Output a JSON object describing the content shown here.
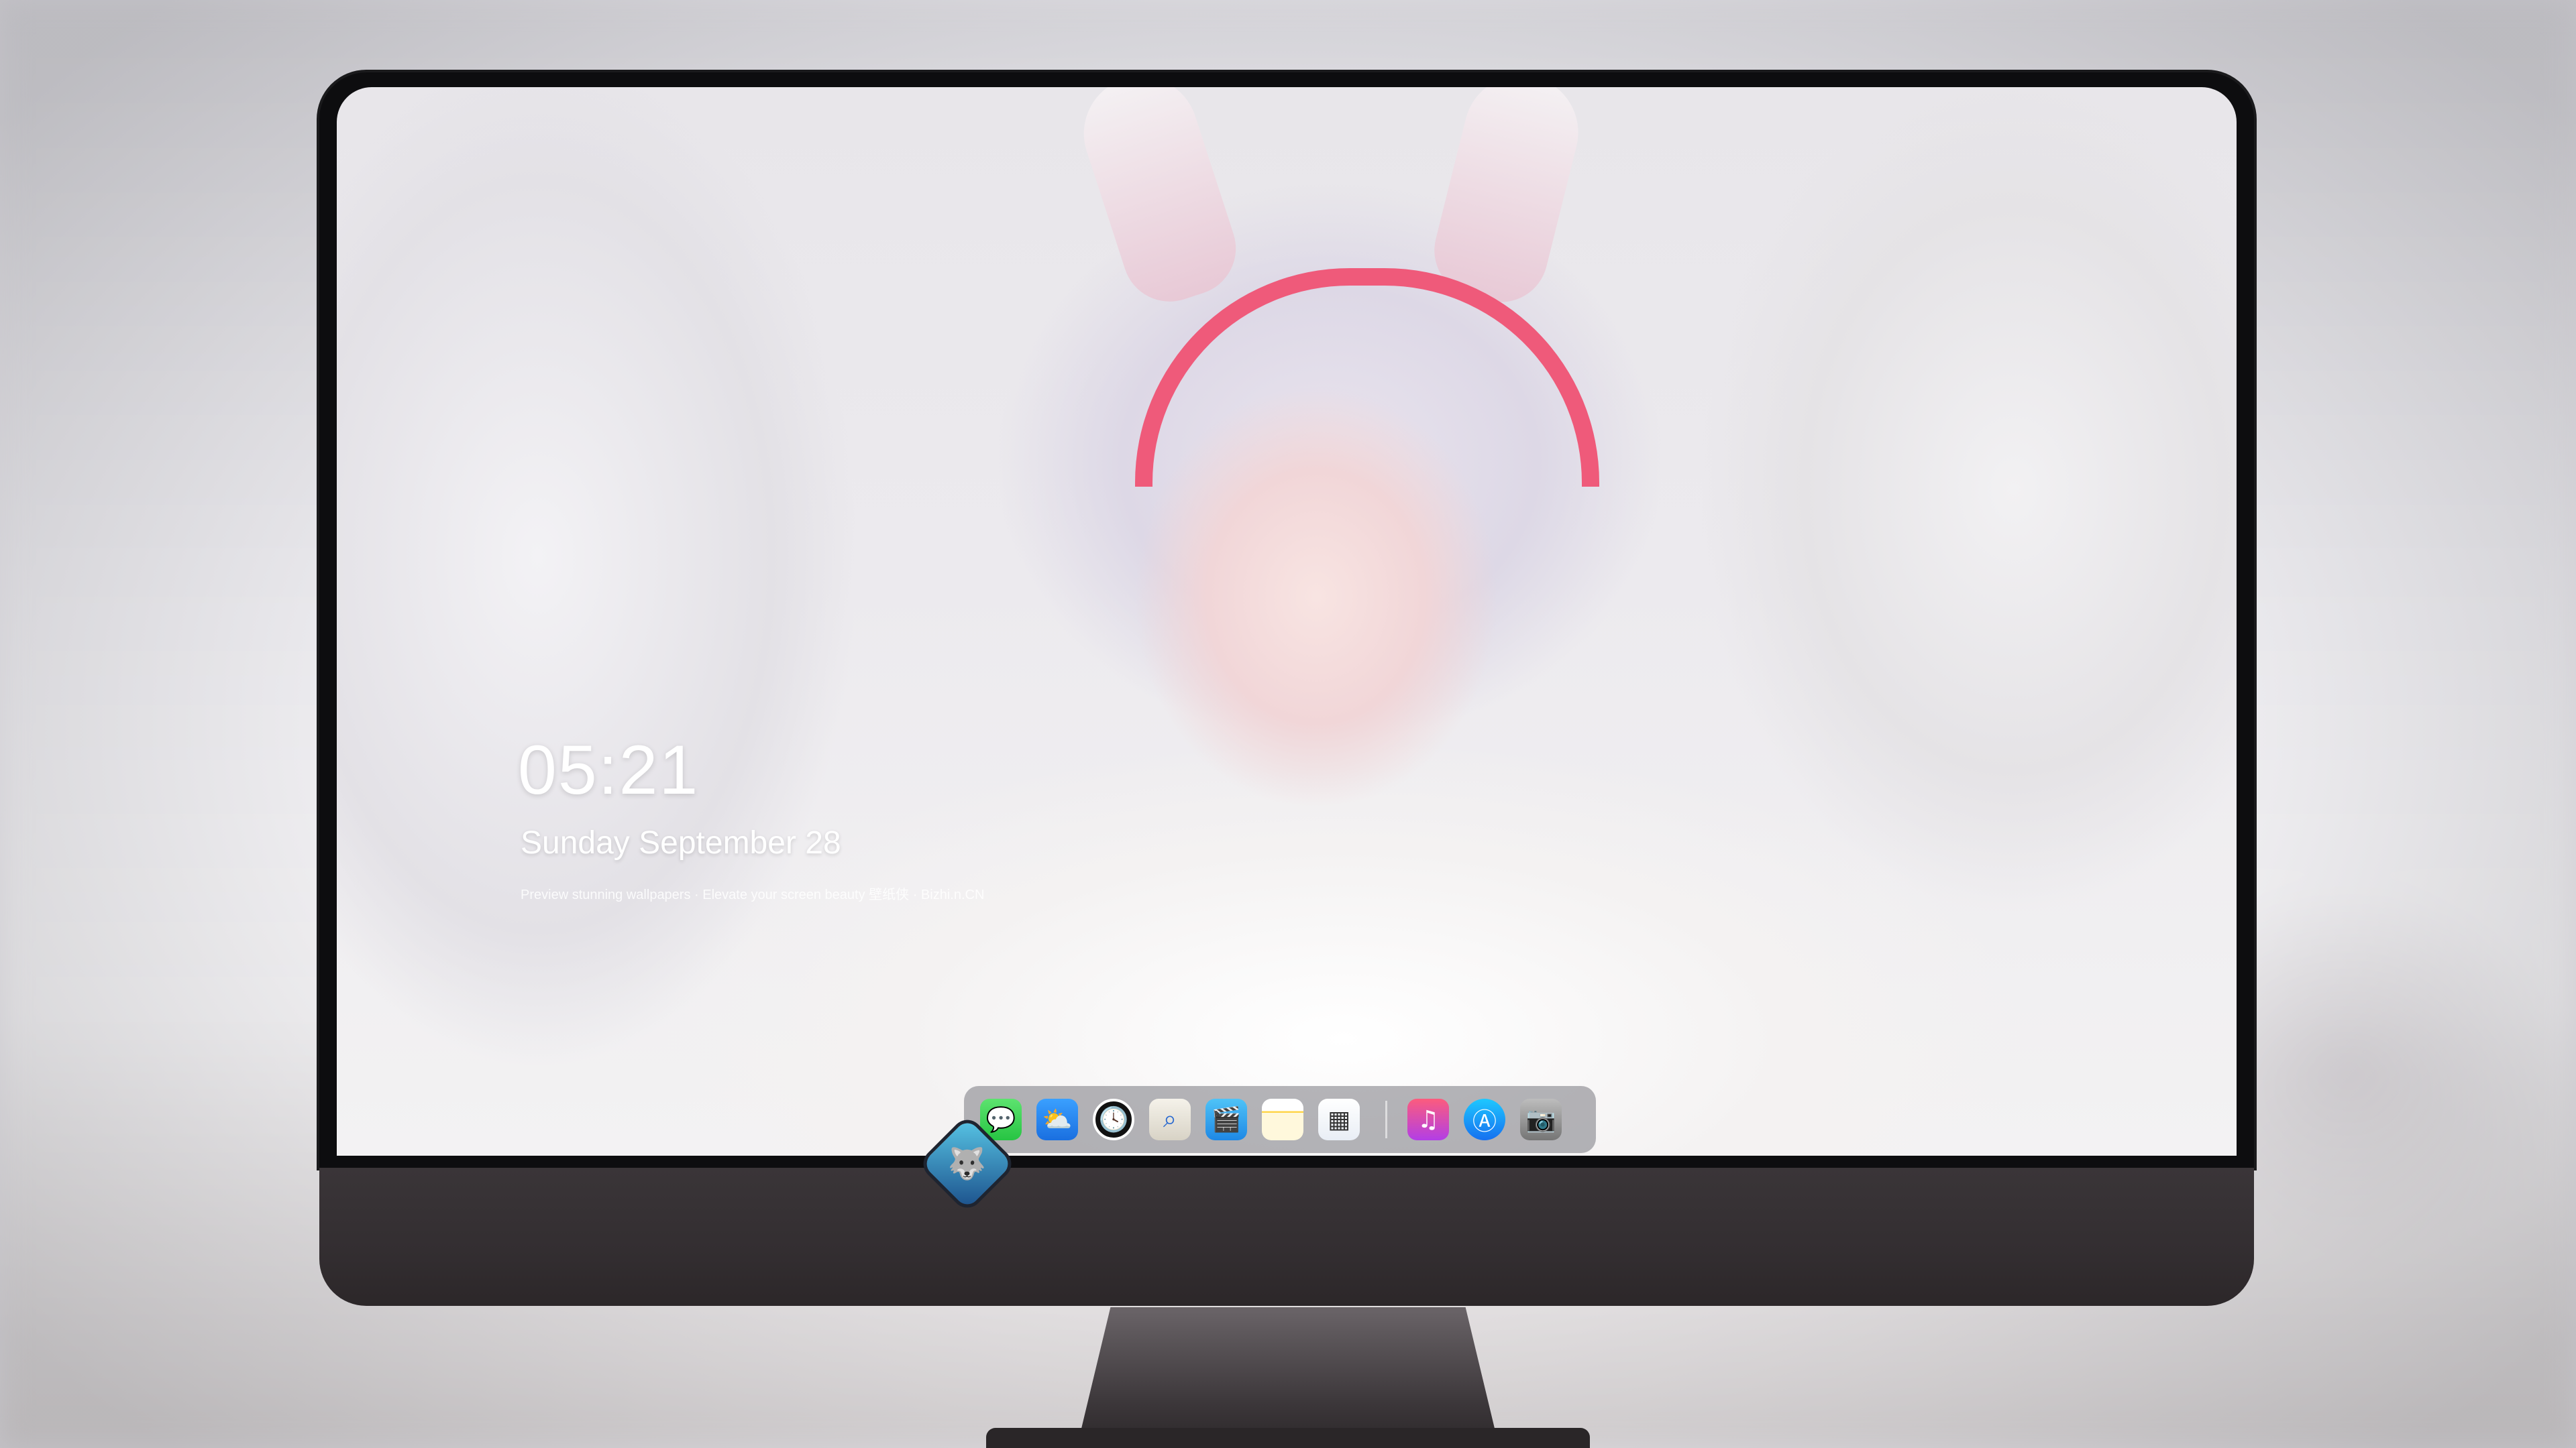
{
  "lockscreen": {
    "time": "05:21",
    "date": "Sunday September  28",
    "tagline": "Preview stunning wallpapers · Elevate your screen beauty 壁纸侠 · Bizhi.n.CN"
  },
  "dock": {
    "apps": [
      {
        "name": "messages-icon",
        "glyph": "💬"
      },
      {
        "name": "weather-icon",
        "glyph": "⛅"
      },
      {
        "name": "clock-icon",
        "glyph": "🕓"
      },
      {
        "name": "preview-icon",
        "glyph": "⌕"
      },
      {
        "name": "clips-icon",
        "glyph": "🎬"
      },
      {
        "name": "notes-icon",
        "glyph": ""
      },
      {
        "name": "photos-icon",
        "glyph": "▦"
      },
      {
        "name": "music-icon",
        "glyph": "♫"
      },
      {
        "name": "app-store-icon",
        "glyph": "Ⓐ"
      },
      {
        "name": "camera-icon",
        "glyph": "📷"
      }
    ]
  },
  "monitor": {
    "logo_glyph": "🐺"
  }
}
